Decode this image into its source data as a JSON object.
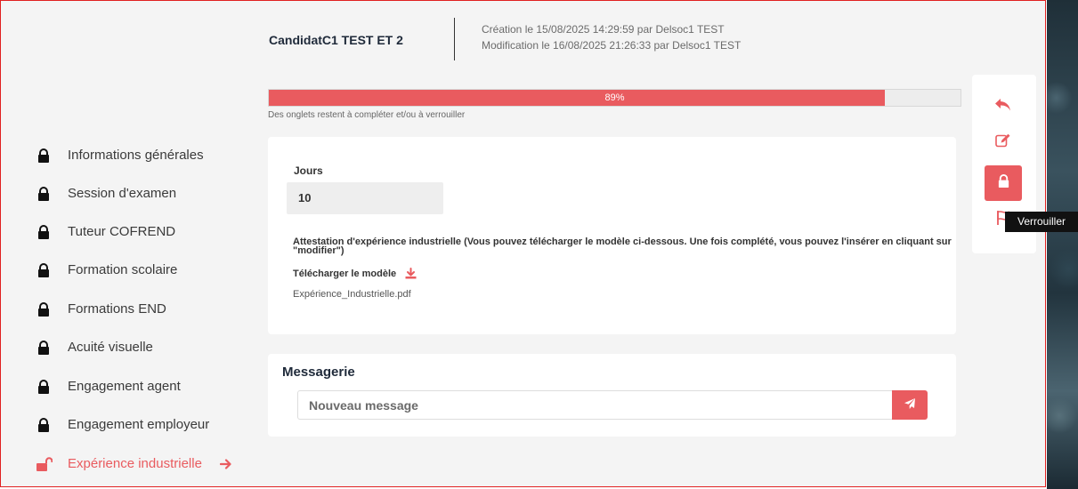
{
  "header": {
    "candidate_name": "CandidatC1 TEST ET 2",
    "created": "Création le 15/08/2025 14:29:59 par Delsoc1 TEST",
    "modified": "Modification le 16/08/2025 21:26:33 par Delsoc1 TEST"
  },
  "progress": {
    "percent": 89,
    "label": "89%",
    "note": "Des onglets restent à compléter et/ou à verrouiller"
  },
  "sidebar": {
    "items": [
      {
        "label": "Informations générales",
        "icon": "lock-icon",
        "locked": true
      },
      {
        "label": "Session d'examen",
        "icon": "lock-icon",
        "locked": true
      },
      {
        "label": "Tuteur COFREND",
        "icon": "lock-icon",
        "locked": true
      },
      {
        "label": "Formation scolaire",
        "icon": "lock-icon",
        "locked": true
      },
      {
        "label": "Formations END",
        "icon": "lock-icon",
        "locked": true
      },
      {
        "label": "Acuité visuelle",
        "icon": "lock-icon",
        "locked": true
      },
      {
        "label": "Engagement agent",
        "icon": "lock-icon",
        "locked": true
      },
      {
        "label": "Engagement employeur",
        "icon": "lock-icon",
        "locked": true
      },
      {
        "label": "Expérience industrielle",
        "icon": "unlock-icon",
        "locked": false,
        "active": true
      }
    ]
  },
  "form": {
    "jours_label": "Jours",
    "jours_value": "10",
    "attestation_label": "Attestation d'expérience industrielle (Vous pouvez télécharger le modèle ci-dessous. Une fois complété, vous pouvez l'insérer en cliquant sur \"modifier\")",
    "download_label": "Télécharger le modèle",
    "file_name": "Expérience_Industrielle.pdf"
  },
  "messaging": {
    "title": "Messagerie",
    "placeholder": "Nouveau message"
  },
  "actions": {
    "tooltip": "Verrouiller",
    "icons": [
      "back-arrow-icon",
      "edit-icon",
      "lock-icon",
      "flag-icon"
    ]
  },
  "colors": {
    "accent": "#e95b5f",
    "text_dark": "#1f2a3a",
    "background": "#f4f4f4"
  }
}
